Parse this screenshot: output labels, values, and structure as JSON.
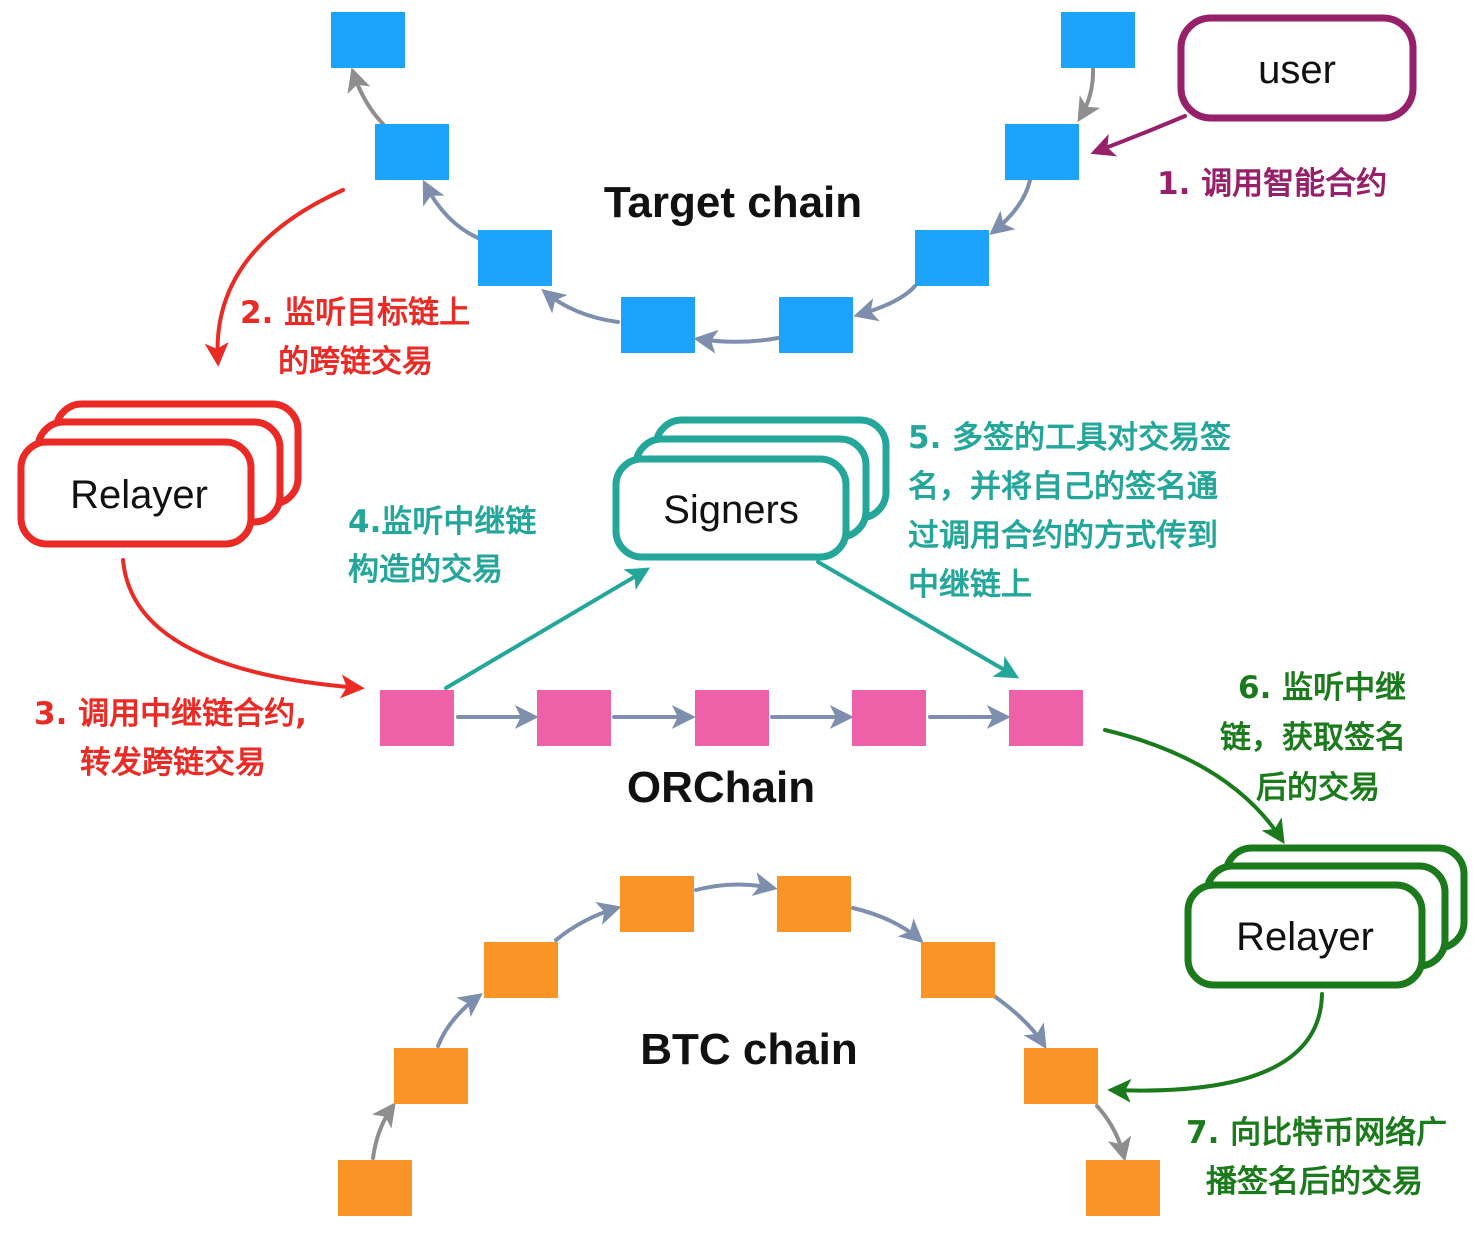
{
  "titles": {
    "target_chain": "Target chain",
    "orchain": "ORChain",
    "btc_chain": "BTC chain"
  },
  "actors": {
    "user": "user",
    "relayer_left": "Relayer",
    "signers": "Signers",
    "relayer_right": "Relayer"
  },
  "steps": {
    "s1": {
      "lines": [
        "1. 调用智能合约"
      ]
    },
    "s2": {
      "lines": [
        "2. 监听目标链上",
        "的跨链交易"
      ]
    },
    "s3": {
      "lines": [
        "3. 调用中继链合约,",
        "转发跨链交易"
      ]
    },
    "s4": {
      "lines": [
        "4.监听中继链",
        "构造的交易"
      ]
    },
    "s5": {
      "lines": [
        "5.  多签的工具对交易签",
        "名，并将自己的签名通",
        "过调用合约的方式传到",
        "中继链上"
      ]
    },
    "s6": {
      "lines": [
        "6. 监听中继",
        "链，获取签名",
        "后的交易"
      ]
    },
    "s7": {
      "lines": [
        "7. 向比特币网络广",
        "播签名后的交易"
      ]
    }
  },
  "colors": {
    "target_block": "#1ea3fb",
    "orchain_block": "#ee60a8",
    "btc_block": "#fb9426",
    "chain_arrow": "#7d8fac",
    "grey_arrow": "#8e8e8e",
    "user": "#96206a",
    "relayer_left": "#ea2a24",
    "signers": "#24a79a",
    "relayer_right": "#1b7a1b"
  }
}
